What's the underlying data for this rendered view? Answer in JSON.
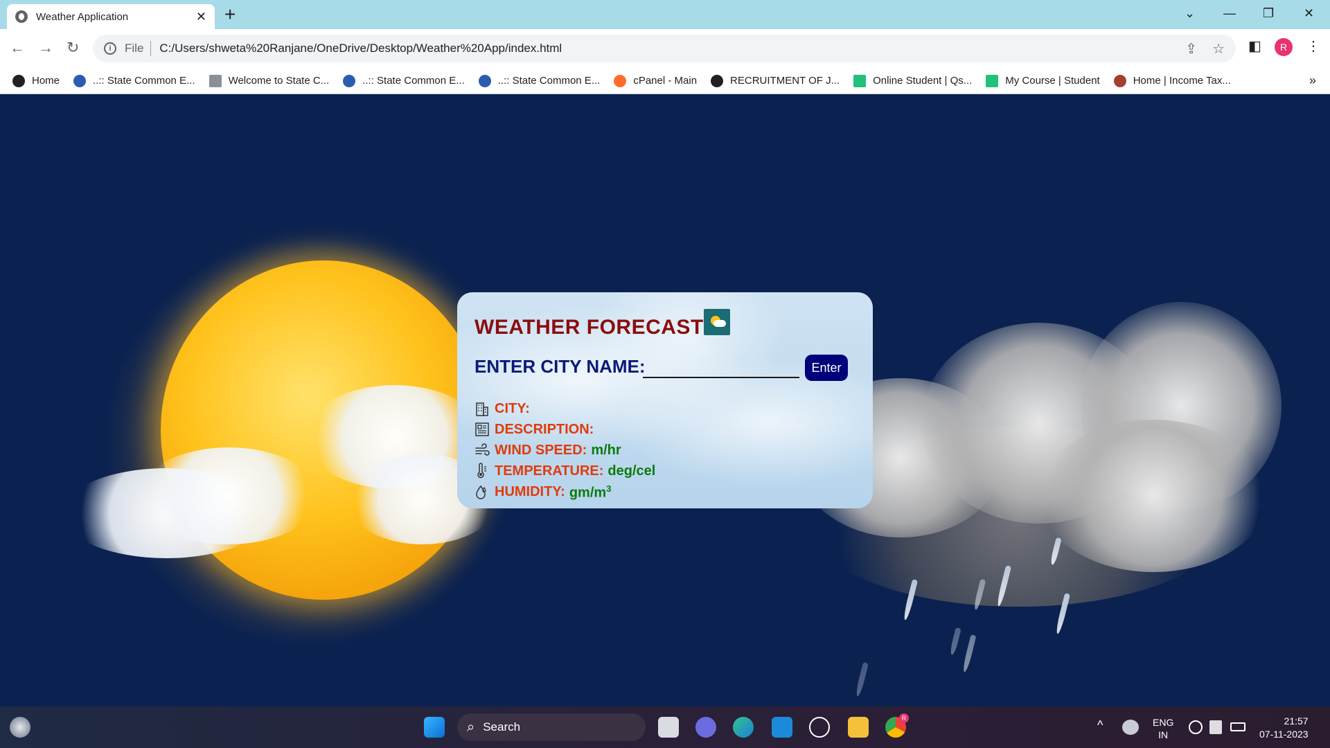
{
  "browser": {
    "tab_title": "Weather Application",
    "tab_close": "✕",
    "new_tab": "+",
    "window_controls": {
      "dropdown": "⌄",
      "minimize": "—",
      "restore": "❐",
      "close": "✕"
    },
    "nav": {
      "back": "←",
      "forward": "→",
      "reload": "↻"
    },
    "address": {
      "scheme": "File",
      "url": "C:/Users/shweta%20Ranjane/OneDrive/Desktop/Weather%20App/index.html"
    },
    "omnibox_icons": {
      "share": "⇪",
      "star": "☆"
    },
    "sidepanel_icon": "◧",
    "menu_icon": "⋮",
    "profile_initial": "R",
    "bookmarks": [
      {
        "label": "Home",
        "color": "#202124"
      },
      {
        "label": "..:: State Common E...",
        "color": "#2a5db0"
      },
      {
        "label": "Welcome to State C...",
        "color": "#8a8f98"
      },
      {
        "label": "..:: State Common E...",
        "color": "#2a5db0"
      },
      {
        "label": "..:: State Common E...",
        "color": "#2a5db0"
      },
      {
        "label": "cPanel - Main",
        "color": "#ff6c2c"
      },
      {
        "label": "RECRUITMENT OF J...",
        "color": "#202124"
      },
      {
        "label": "Online Student | Qs...",
        "color": "#22c07a"
      },
      {
        "label": "My Course | Student",
        "color": "#22c07a"
      },
      {
        "label": "Home | Income Tax...",
        "color": "#a04030"
      }
    ],
    "bookmarks_more": "»"
  },
  "app": {
    "title": "WEATHER FORECAST",
    "city_label": "ENTER CITY NAME:",
    "city_input_value": "",
    "enter_button": "Enter",
    "fields": {
      "city": {
        "label": "CITY:",
        "value": ""
      },
      "description": {
        "label": "DESCRIPTION:",
        "value": ""
      },
      "wind": {
        "label": "WIND SPEED:",
        "value": "m/hr"
      },
      "temperature": {
        "label": "TEMPERATURE:",
        "value": "deg/cel"
      },
      "humidity": {
        "label": "HUMIDITY:",
        "value": "gm/m",
        "sup": "3"
      }
    },
    "colors": {
      "title": "#8b0d0d",
      "city_label": "#0b1a78",
      "field_label": "#e03b0c",
      "field_value": "#0c7a0c",
      "button": "#00007a"
    }
  },
  "taskbar": {
    "search_label": "Search",
    "tray_chevron": "^",
    "language": {
      "line1": "ENG",
      "line2": "IN"
    },
    "time": "21:57",
    "date": "07-11-2023",
    "chrome_badge": "R"
  }
}
